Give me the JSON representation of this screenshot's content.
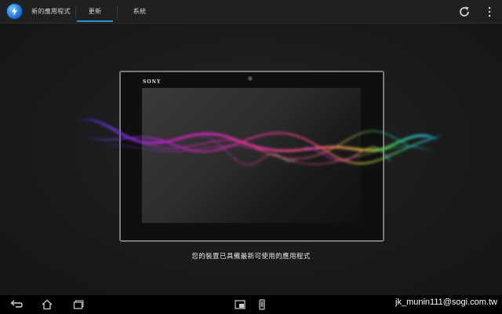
{
  "header": {
    "tabs": [
      {
        "label": "新的應用程式"
      },
      {
        "label": "更新"
      },
      {
        "label": "系統"
      }
    ],
    "selected_tab": 1,
    "refresh_icon": "refresh-icon",
    "overflow_icon": "overflow-menu-icon"
  },
  "main": {
    "device_brand": "SONY",
    "message": "您的裝置已具備最新可使用的應用程式"
  },
  "navbar": {
    "icons": [
      "back-icon",
      "home-icon",
      "recent-apps-icon",
      "small-app-window-icon",
      "phone-icon"
    ],
    "watermark": "jk_munin111@sogi.com.tw"
  },
  "colors": {
    "accent": "#2a8fd6",
    "background": "#1b1b1b"
  }
}
